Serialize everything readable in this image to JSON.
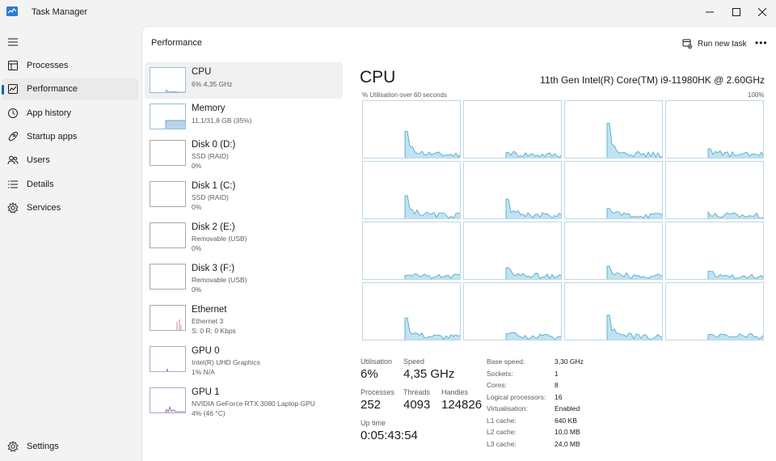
{
  "window": {
    "title": "Task Manager"
  },
  "sidebar": {
    "items": [
      {
        "label": "Processes",
        "icon": "processes-icon"
      },
      {
        "label": "Performance",
        "icon": "performance-icon",
        "active": true
      },
      {
        "label": "App history",
        "icon": "app-history-icon"
      },
      {
        "label": "Startup apps",
        "icon": "startup-apps-icon"
      },
      {
        "label": "Users",
        "icon": "users-icon"
      },
      {
        "label": "Details",
        "icon": "details-icon"
      },
      {
        "label": "Services",
        "icon": "services-icon"
      }
    ],
    "settings_label": "Settings"
  },
  "header": {
    "title": "Performance",
    "run_task_label": "Run new task",
    "more_label": "•••"
  },
  "devices": [
    {
      "name": "CPU",
      "line1": "6% 4,35 GHz",
      "line2": ""
    },
    {
      "name": "Memory",
      "line1": "11,1/31,8 GB (35%)",
      "line2": ""
    },
    {
      "name": "Disk 0 (D:)",
      "line1": "SSD (RAID)",
      "line2": "0%"
    },
    {
      "name": "Disk 1 (C:)",
      "line1": "SSD (RAID)",
      "line2": "0%"
    },
    {
      "name": "Disk 2 (E:)",
      "line1": "Removable (USB)",
      "line2": "0%"
    },
    {
      "name": "Disk 3 (F:)",
      "line1": "Removable (USB)",
      "line2": "0%"
    },
    {
      "name": "Ethernet",
      "line1": "Ethernet 3",
      "line2": "S: 0 R: 0 Kbps"
    },
    {
      "name": "GPU 0",
      "line1": "Intel(R) UHD Graphics",
      "line2": "1% N/A"
    },
    {
      "name": "GPU 1",
      "line1": "NVIDIA GeForce RTX 3080 Laptop GPU",
      "line2": "4% (46 °C)"
    }
  ],
  "cpu": {
    "title": "CPU",
    "model": "11th Gen Intel(R) Core(TM) i9-11980HK @ 2.60GHz",
    "graph_caption": "% Utilisation over 60 seconds",
    "graph_max": "100%",
    "colors": {
      "line": "#4ba3c7",
      "fill": "#bfe3f2",
      "border": "#bdd7e6"
    }
  },
  "stats": {
    "utilisation": {
      "label": "Utilisation",
      "value": "6%"
    },
    "speed": {
      "label": "Speed",
      "value": "4,35 GHz"
    },
    "processes": {
      "label": "Processes",
      "value": "252"
    },
    "threads": {
      "label": "Threads",
      "value": "4093"
    },
    "handles": {
      "label": "Handles",
      "value": "124826"
    },
    "uptime": {
      "label": "Up time",
      "value": "0:05:43:54"
    }
  },
  "specs": [
    {
      "label": "Base speed:",
      "value": "3,30 GHz"
    },
    {
      "label": "Sockets:",
      "value": "1"
    },
    {
      "label": "Cores:",
      "value": "8"
    },
    {
      "label": "Logical processors:",
      "value": "16"
    },
    {
      "label": "Virtualisation:",
      "value": "Enabled"
    },
    {
      "label": "L1 cache:",
      "value": "640 KB"
    },
    {
      "label": "L2 cache:",
      "value": "10,0 MB"
    },
    {
      "label": "L3 cache:",
      "value": "24,0 MB"
    }
  ]
}
